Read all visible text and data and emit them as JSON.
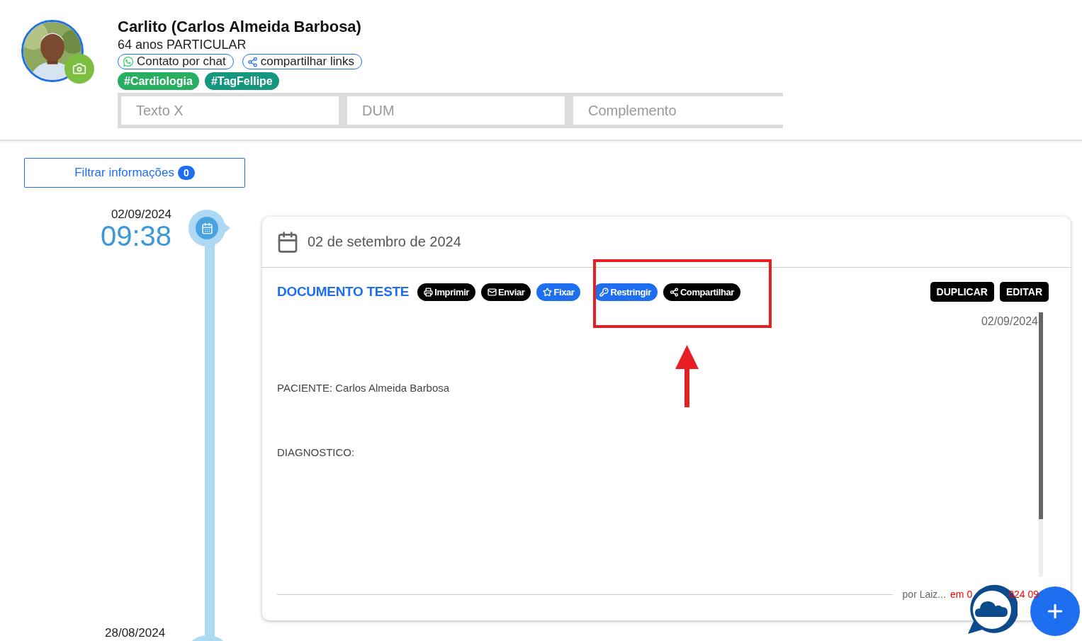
{
  "patient": {
    "name": "Carlito (Carlos Almeida Barbosa)",
    "subtitle": "64 anos PARTICULAR",
    "links": [
      {
        "kind": "chat",
        "label": "Contato por chat"
      },
      {
        "kind": "share",
        "label": "compartilhar links"
      }
    ],
    "tags": [
      {
        "label": "#Cardiologia",
        "color": "#27ae60"
      },
      {
        "label": "#TagFellipe",
        "color": "#14967f"
      }
    ],
    "fields": [
      {
        "placeholder": "Texto X"
      },
      {
        "placeholder": "DUM"
      },
      {
        "placeholder": "Complemento"
      }
    ]
  },
  "filter": {
    "label": "Filtrar informações",
    "count": "0"
  },
  "timeline": [
    {
      "date": "02/09/2024",
      "time": "09:38",
      "card": {
        "heading": "02 de setembro de 2024",
        "title": "DOCUMENTO TESTE",
        "actions": [
          {
            "kind": "print",
            "label": "Imprimir"
          },
          {
            "kind": "mail",
            "label": "Enviar"
          },
          {
            "kind": "star",
            "label": "Fixar"
          },
          {
            "kind": "key",
            "label": "Restringir"
          },
          {
            "kind": "share",
            "label": "Compartilhar"
          }
        ],
        "edit_actions": [
          "DUPLICAR",
          "EDITAR"
        ],
        "doc_date": "02/09/2024",
        "lines": [
          "PACIENTE: Carlos Almeida Barbosa",
          "DIAGNOSTICO:"
        ],
        "author": "por Laiz...",
        "edited": [
          "em 0",
          "024 09"
        ]
      }
    },
    {
      "date": "28/08/2024"
    }
  ]
}
